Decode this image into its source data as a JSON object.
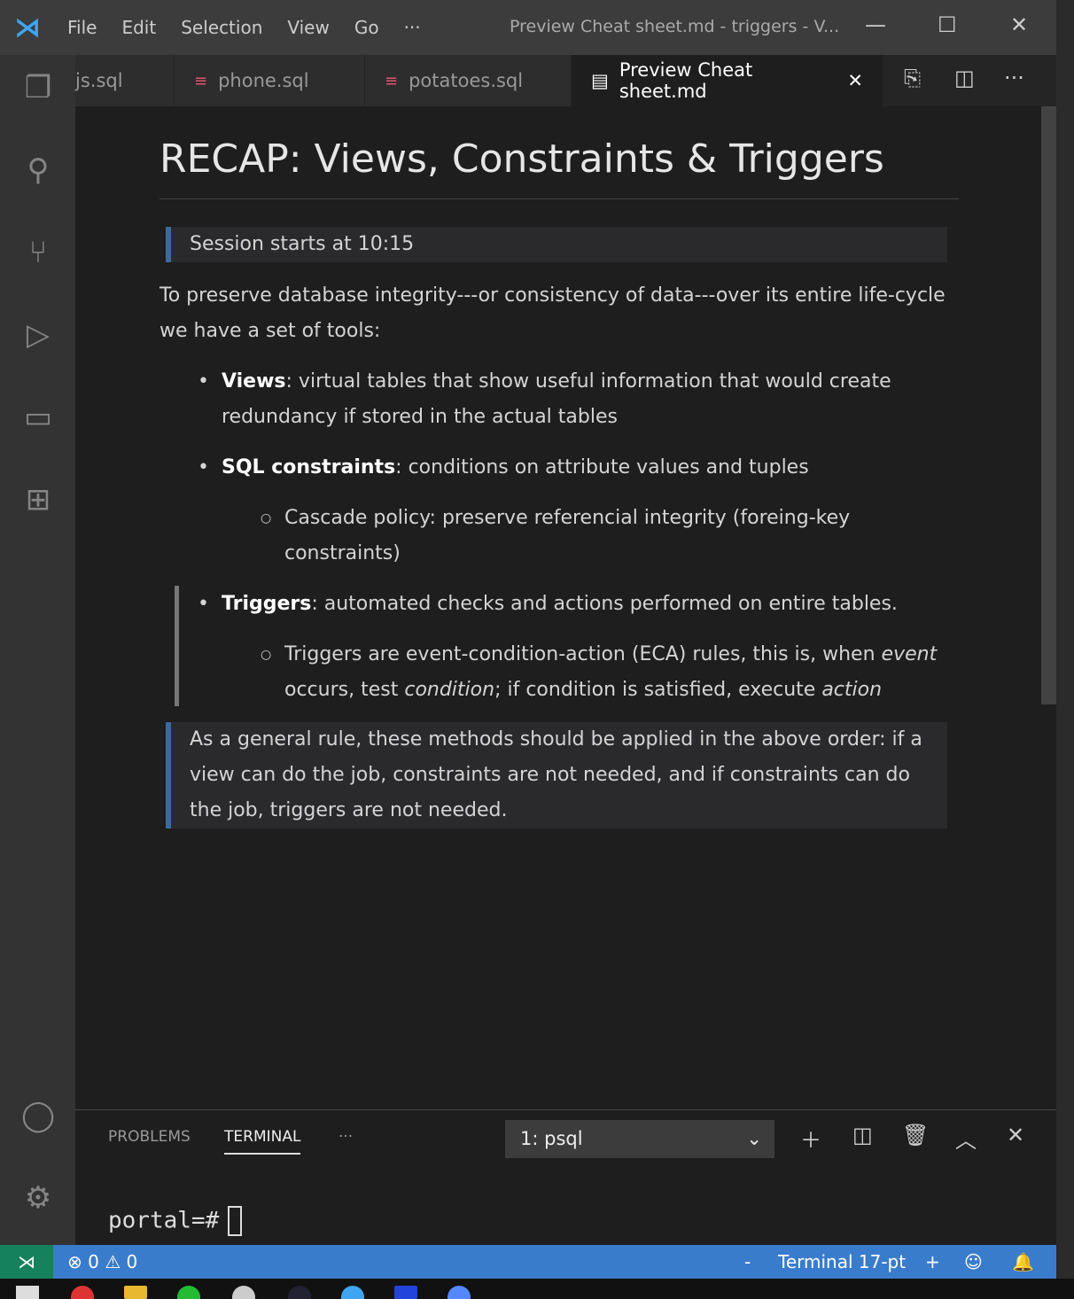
{
  "titlebar": {
    "menu": [
      "File",
      "Edit",
      "Selection",
      "View",
      "Go",
      "···"
    ],
    "title": "Preview Cheat sheet.md - triggers - V..."
  },
  "tabs": [
    {
      "label": "js.sql"
    },
    {
      "label": "phone.sql"
    },
    {
      "label": "potatoes.sql"
    },
    {
      "label": "Preview Cheat sheet.md",
      "active": true
    }
  ],
  "doc": {
    "title": "RECAP: Views, Constraints & Triggers",
    "session": "Session starts at 10:15",
    "intro": "To preserve database integrity---or consistency of data---over its entire life-cycle we have a set of tools:",
    "items": [
      {
        "term": "Views",
        "text": ": virtual tables that show useful information that would create redundancy if stored in the actual tables"
      },
      {
        "term": "SQL constraints",
        "text": ": conditions on attribute values and tuples",
        "sub": "Cascade policy: preserve referencial integrity (foreing-key constraints)"
      },
      {
        "term": "Triggers",
        "text": ": automated checks and actions performed on entire tables.",
        "sub": {
          "a": "Triggers are event-condition-action (ECA) rules, this is, when ",
          "b": "event",
          "c": " occurs, test ",
          "d": "condition",
          "e": "; if condition is satisfied, execute ",
          "f": "action"
        }
      }
    ],
    "rule": "As a general rule, these methods should be applied in the above order: if a view can do the job, constraints are not needed, and if constraints can do the job, triggers are not needed."
  },
  "panel": {
    "tabs": [
      "PROBLEMS",
      "TERMINAL",
      "···"
    ],
    "active_tab": "TERMINAL",
    "terminal_select": "1: psql",
    "prompt": "portal=#"
  },
  "status": {
    "errors": "0",
    "warnings": "0",
    "minus": "-",
    "font": "Terminal 17-pt",
    "plus": "+"
  },
  "colors": {
    "statusbar": "#3a7ccc",
    "remote": "#16825d",
    "quote_border": "#3a6aa0"
  }
}
